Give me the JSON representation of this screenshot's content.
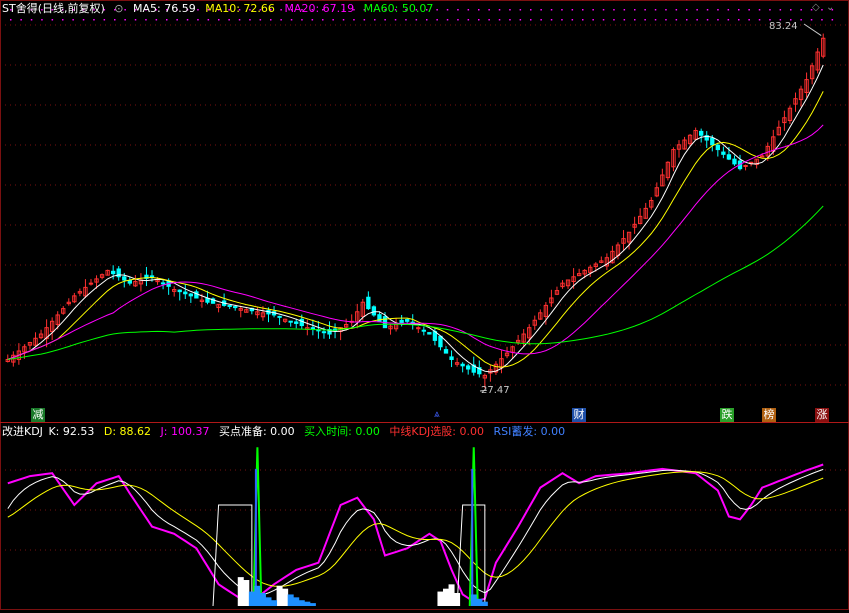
{
  "header": {
    "title": "ST舍得(日线,前复权)",
    "ma": [
      {
        "label": "MA5: 76.59",
        "color": "#ffffff"
      },
      {
        "label": "MA10: 72.66",
        "color": "#ffff00"
      },
      {
        "label": "MA20: 67.19",
        "color": "#ff00ff"
      },
      {
        "label": "MA60: 50.07",
        "color": "#00ff00"
      }
    ]
  },
  "annotations": {
    "high": "83.24",
    "low": "27.47"
  },
  "markers": [
    {
      "text": "减",
      "bg": "#1a7a2a"
    },
    {
      "text": "财",
      "bg": "#1e4fa8"
    },
    {
      "text": "跌",
      "bg": "#2aa02a"
    },
    {
      "text": "榜",
      "bg": "#b06010"
    },
    {
      "text": "涨",
      "bg": "#8a1010"
    }
  ],
  "indicator": {
    "name": "改进KDJ",
    "items": [
      {
        "label": "K: 92.53",
        "color": "#ffffff"
      },
      {
        "label": "D: 88.62",
        "color": "#ffff00"
      },
      {
        "label": "J: 100.37",
        "color": "#ff00ff"
      },
      {
        "label": "买点准备: 0.00",
        "color": "#ffffff"
      },
      {
        "label": "买入时间: 0.00",
        "color": "#00ff00"
      },
      {
        "label": "中线KDJ选股: 0.00",
        "color": "#ff3030"
      },
      {
        "label": "RSI蓄发: 0.00",
        "color": "#4080ff"
      }
    ]
  },
  "colors": {
    "up": "#ff3030",
    "down": "#00ffff",
    "grid": "#7a1010",
    "ma5": "#ffffff",
    "ma10": "#ffff00",
    "ma20": "#ff00ff",
    "ma60": "#00ff00"
  },
  "chart_data": [
    {
      "type": "candlestick",
      "title": "ST舍得(日线,前复权)",
      "ylim": [
        25,
        86
      ],
      "n": 148,
      "price_points": [
        [
          0,
          32
        ],
        [
          6,
          36
        ],
        [
          12,
          42
        ],
        [
          18,
          46
        ],
        [
          22,
          44
        ],
        [
          26,
          45
        ],
        [
          30,
          43
        ],
        [
          36,
          41
        ],
        [
          42,
          40
        ],
        [
          48,
          39
        ],
        [
          54,
          37
        ],
        [
          58,
          36
        ],
        [
          62,
          38
        ],
        [
          64,
          41
        ],
        [
          68,
          37
        ],
        [
          72,
          38
        ],
        [
          76,
          36
        ],
        [
          80,
          32
        ],
        [
          84,
          30
        ],
        [
          86,
          29.5
        ],
        [
          90,
          33
        ],
        [
          94,
          37
        ],
        [
          100,
          44
        ],
        [
          104,
          46
        ],
        [
          108,
          48
        ],
        [
          112,
          52
        ],
        [
          116,
          57
        ],
        [
          120,
          65
        ],
        [
          124,
          68
        ],
        [
          128,
          65
        ],
        [
          132,
          62
        ],
        [
          136,
          64
        ],
        [
          140,
          70
        ],
        [
          144,
          76
        ],
        [
          147,
          82.5
        ]
      ],
      "highlights": {
        "high": 83.24,
        "low": 27.47
      },
      "ma_last": {
        "MA5": 76.59,
        "MA10": 72.66,
        "MA20": 67.19,
        "MA60": 50.07
      }
    },
    {
      "type": "line",
      "title": "改进KDJ",
      "ylim": [
        0,
        115
      ],
      "j_points": [
        [
          0,
          85
        ],
        [
          4,
          90
        ],
        [
          8,
          92
        ],
        [
          12,
          70
        ],
        [
          16,
          85
        ],
        [
          20,
          90
        ],
        [
          22,
          78
        ],
        [
          26,
          55
        ],
        [
          30,
          50
        ],
        [
          34,
          40
        ],
        [
          38,
          15
        ],
        [
          42,
          5
        ],
        [
          44,
          3
        ],
        [
          48,
          15
        ],
        [
          52,
          25
        ],
        [
          56,
          30
        ],
        [
          60,
          70
        ],
        [
          63,
          75
        ],
        [
          66,
          60
        ],
        [
          68,
          35
        ],
        [
          72,
          40
        ],
        [
          76,
          50
        ],
        [
          78,
          45
        ],
        [
          80,
          25
        ],
        [
          82,
          8
        ],
        [
          84,
          3
        ],
        [
          86,
          5
        ],
        [
          88,
          30
        ],
        [
          92,
          55
        ],
        [
          96,
          82
        ],
        [
          100,
          92
        ],
        [
          103,
          85
        ],
        [
          106,
          90
        ],
        [
          112,
          92
        ],
        [
          118,
          95
        ],
        [
          124,
          92
        ],
        [
          128,
          80
        ],
        [
          130,
          62
        ],
        [
          132,
          60
        ],
        [
          134,
          70
        ],
        [
          136,
          82
        ],
        [
          140,
          88
        ],
        [
          144,
          94
        ],
        [
          147,
          98
        ]
      ],
      "current": {
        "K": 92.53,
        "D": 88.62,
        "J": 100.37
      }
    }
  ]
}
